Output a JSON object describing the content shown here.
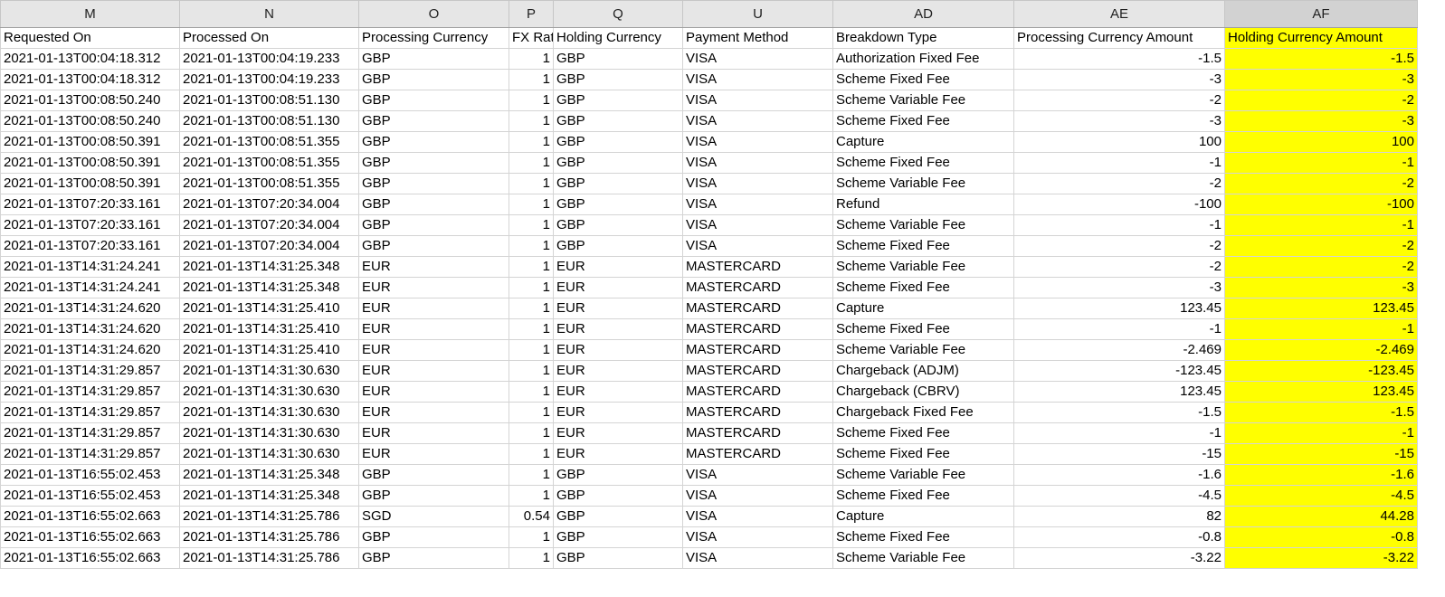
{
  "columns": [
    "M",
    "N",
    "O",
    "P",
    "Q",
    "U",
    "AD",
    "AE",
    "AF"
  ],
  "headers": [
    "Requested On",
    "Processed On",
    "Processing Currency",
    "FX Rat",
    "Holding Currency",
    "Payment Method",
    "Breakdown Type",
    "Processing Currency Amount",
    "Holding Currency Amount"
  ],
  "highlight_color": "#ffff00",
  "rows": [
    [
      "2021-01-13T00:04:18.312",
      "2021-01-13T00:04:19.233",
      "GBP",
      "1",
      "GBP",
      "VISA",
      "Authorization Fixed Fee",
      "-1.5",
      "-1.5"
    ],
    [
      "2021-01-13T00:04:18.312",
      "2021-01-13T00:04:19.233",
      "GBP",
      "1",
      "GBP",
      "VISA",
      "Scheme Fixed Fee",
      "-3",
      "-3"
    ],
    [
      "2021-01-13T00:08:50.240",
      "2021-01-13T00:08:51.130",
      "GBP",
      "1",
      "GBP",
      "VISA",
      "Scheme Variable Fee",
      "-2",
      "-2"
    ],
    [
      "2021-01-13T00:08:50.240",
      "2021-01-13T00:08:51.130",
      "GBP",
      "1",
      "GBP",
      "VISA",
      "Scheme Fixed Fee",
      "-3",
      "-3"
    ],
    [
      "2021-01-13T00:08:50.391",
      "2021-01-13T00:08:51.355",
      "GBP",
      "1",
      "GBP",
      "VISA",
      "Capture",
      "100",
      "100"
    ],
    [
      "2021-01-13T00:08:50.391",
      "2021-01-13T00:08:51.355",
      "GBP",
      "1",
      "GBP",
      "VISA",
      "Scheme Fixed Fee",
      "-1",
      "-1"
    ],
    [
      "2021-01-13T00:08:50.391",
      "2021-01-13T00:08:51.355",
      "GBP",
      "1",
      "GBP",
      "VISA",
      "Scheme Variable Fee",
      "-2",
      "-2"
    ],
    [
      "2021-01-13T07:20:33.161",
      "2021-01-13T07:20:34.004",
      "GBP",
      "1",
      "GBP",
      "VISA",
      "Refund",
      "-100",
      "-100"
    ],
    [
      "2021-01-13T07:20:33.161",
      "2021-01-13T07:20:34.004",
      "GBP",
      "1",
      "GBP",
      "VISA",
      "Scheme Variable Fee",
      "-1",
      "-1"
    ],
    [
      "2021-01-13T07:20:33.161",
      "2021-01-13T07:20:34.004",
      "GBP",
      "1",
      "GBP",
      "VISA",
      "Scheme Fixed Fee",
      "-2",
      "-2"
    ],
    [
      "2021-01-13T14:31:24.241",
      "2021-01-13T14:31:25.348",
      "EUR",
      "1",
      "EUR",
      "MASTERCARD",
      "Scheme Variable Fee",
      "-2",
      "-2"
    ],
    [
      "2021-01-13T14:31:24.241",
      "2021-01-13T14:31:25.348",
      "EUR",
      "1",
      "EUR",
      "MASTERCARD",
      "Scheme Fixed Fee",
      "-3",
      "-3"
    ],
    [
      "2021-01-13T14:31:24.620",
      "2021-01-13T14:31:25.410",
      "EUR",
      "1",
      "EUR",
      "MASTERCARD",
      "Capture",
      "123.45",
      "123.45"
    ],
    [
      "2021-01-13T14:31:24.620",
      "2021-01-13T14:31:25.410",
      "EUR",
      "1",
      "EUR",
      "MASTERCARD",
      "Scheme Fixed Fee",
      "-1",
      "-1"
    ],
    [
      "2021-01-13T14:31:24.620",
      "2021-01-13T14:31:25.410",
      "EUR",
      "1",
      "EUR",
      "MASTERCARD",
      "Scheme Variable Fee",
      "-2.469",
      "-2.469"
    ],
    [
      "2021-01-13T14:31:29.857",
      "2021-01-13T14:31:30.630",
      "EUR",
      "1",
      "EUR",
      "MASTERCARD",
      "Chargeback (ADJM)",
      "-123.45",
      "-123.45"
    ],
    [
      "2021-01-13T14:31:29.857",
      "2021-01-13T14:31:30.630",
      "EUR",
      "1",
      "EUR",
      "MASTERCARD",
      "Chargeback (CBRV)",
      "123.45",
      "123.45"
    ],
    [
      "2021-01-13T14:31:29.857",
      "2021-01-13T14:31:30.630",
      "EUR",
      "1",
      "EUR",
      "MASTERCARD",
      "Chargeback Fixed Fee",
      "-1.5",
      "-1.5"
    ],
    [
      "2021-01-13T14:31:29.857",
      "2021-01-13T14:31:30.630",
      "EUR",
      "1",
      "EUR",
      "MASTERCARD",
      "Scheme Fixed Fee",
      "-1",
      "-1"
    ],
    [
      "2021-01-13T14:31:29.857",
      "2021-01-13T14:31:30.630",
      "EUR",
      "1",
      "EUR",
      "MASTERCARD",
      "Scheme Fixed Fee",
      "-15",
      "-15"
    ],
    [
      "2021-01-13T16:55:02.453",
      "2021-01-13T14:31:25.348",
      "GBP",
      "1",
      "GBP",
      "VISA",
      "Scheme Variable Fee",
      "-1.6",
      "-1.6"
    ],
    [
      "2021-01-13T16:55:02.453",
      "2021-01-13T14:31:25.348",
      "GBP",
      "1",
      "GBP",
      "VISA",
      "Scheme Fixed Fee",
      "-4.5",
      "-4.5"
    ],
    [
      "2021-01-13T16:55:02.663",
      "2021-01-13T14:31:25.786",
      "SGD",
      "0.54",
      "GBP",
      "VISA",
      "Capture",
      "82",
      "44.28"
    ],
    [
      "2021-01-13T16:55:02.663",
      "2021-01-13T14:31:25.786",
      "GBP",
      "1",
      "GBP",
      "VISA",
      "Scheme Fixed Fee",
      "-0.8",
      "-0.8"
    ],
    [
      "2021-01-13T16:55:02.663",
      "2021-01-13T14:31:25.786",
      "GBP",
      "1",
      "GBP",
      "VISA",
      "Scheme Variable Fee",
      "-3.22",
      "-3.22"
    ]
  ]
}
